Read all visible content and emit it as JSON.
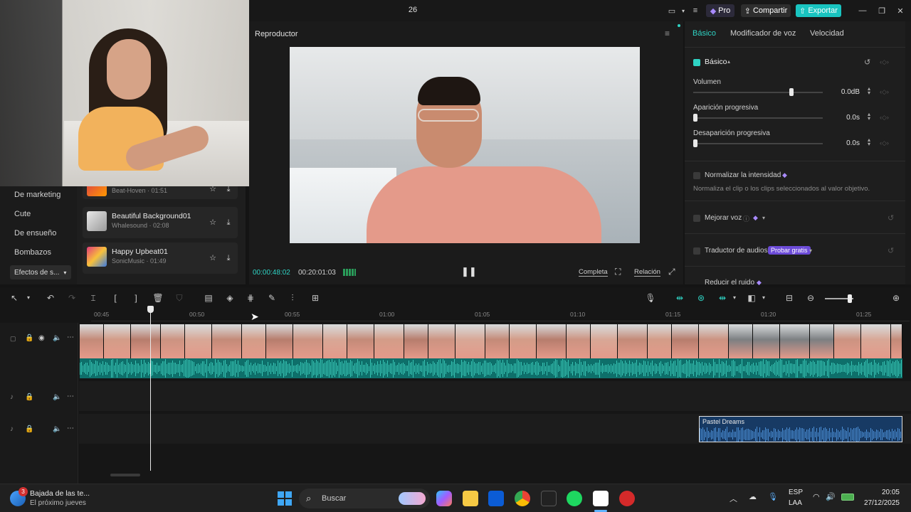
{
  "titlebar": {
    "project_name": "26",
    "pro_label": "Pro",
    "share_label": "Compartir",
    "export_label": "Exportar"
  },
  "left_panel": {
    "categories": [
      "De marketing",
      "Cute",
      "De ensueño",
      "Bombazos"
    ],
    "active_category": "Efectos de s...",
    "tracks": [
      {
        "title": "",
        "sub": "Beat-Hoven · 01:51"
      },
      {
        "title": "Beautiful Background01",
        "sub": "Whalesound · 02:08"
      },
      {
        "title": "Happy Upbeat01",
        "sub": "SonicMusic · 01:49"
      }
    ]
  },
  "player": {
    "title": "Reproductor",
    "current_time": "00:00:48:02",
    "total_time": "00:20:01:03",
    "full_label": "Completa",
    "ratio_label": "Relación"
  },
  "inspector": {
    "tabs": [
      "Básico",
      "Modificador de voz",
      "Velocidad"
    ],
    "section_title": "Básico",
    "volume_label": "Volumen",
    "volume_value": "0.0dB",
    "volume_level": 0.76,
    "fade_in_label": "Aparición progresiva",
    "fade_in_value": "0.0s",
    "fade_out_label": "Desaparición progresiva",
    "fade_out_value": "0.0s",
    "normalize_label": "Normalizar la intensidad",
    "normalize_desc": "Normaliza el clip o los clips seleccionados al valor objetivo.",
    "enhance_label": "Mejorar voz",
    "translator_label": "Traductor de audios",
    "try_free": "Probar gratis",
    "noise_label": "Reducir el ruido"
  },
  "timeline": {
    "ruler": [
      "00:45",
      "00:50",
      "00:55",
      "01:00",
      "01:05",
      "01:10",
      "01:15",
      "01:20",
      "01:25"
    ],
    "music_clip": "Pastel Dreams"
  },
  "taskbar": {
    "news_title": "Bajada de las te...",
    "news_sub": "El próximo jueves",
    "news_badge": "3",
    "search_placeholder": "Buscar",
    "lang": "ESP",
    "lang_sub": "LAA",
    "time": "20:05",
    "date": "27/12/2025"
  },
  "colors": {
    "accent": "#2fd3c4",
    "pro": "#7c5cff",
    "export": "#19c4c0"
  }
}
